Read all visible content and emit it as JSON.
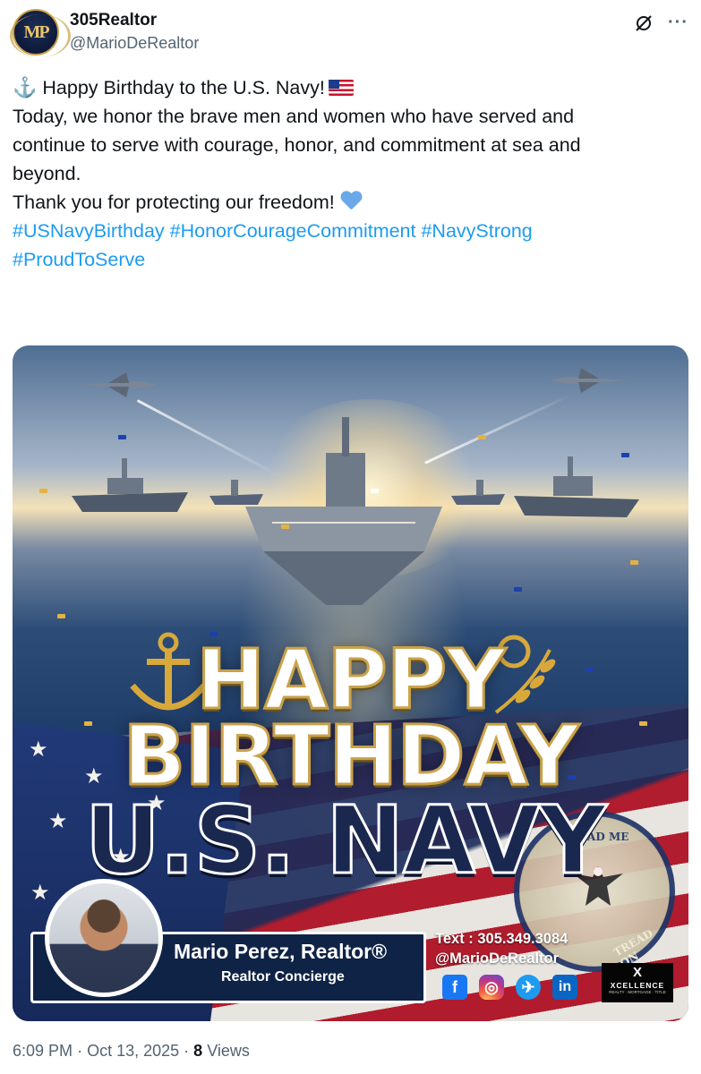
{
  "account": {
    "name": "305Realtor",
    "handle": "@MarioDeRealtor",
    "avatar_icon": "mp-monogram-logo"
  },
  "tweet": {
    "line1": "Happy Birthday to the U.S. Navy!",
    "line2": "Today, we honor the brave men and women who have served and",
    "line3": "continue to serve with courage, honor, and commitment at sea and",
    "line4": "beyond.",
    "line5": "Thank you for protecting our freedom!",
    "hashtags_line1": "#USNavyBirthday #HonorCourageCommitment #NavyStrong",
    "hashtags_line2": "#ProudToServe",
    "emoji": {
      "lead": "anchor-icon",
      "flag": "us-flag-icon",
      "heart": "blue-heart-icon"
    }
  },
  "image": {
    "headline1": "HAPPY",
    "headline2": "BIRTHDAY",
    "headline3": "U.S. NAVY",
    "seal_text_top": "TREAD ME",
    "seal_text_bottom": "TREAD ON",
    "agent_name": "Mario Perez, Realtor®",
    "agent_title": "Realtor Concierge",
    "contact_phone": "Text : 305.349.3084",
    "contact_handle": "@MarioDeRealtor",
    "brand_mark": "X",
    "brand_name": "XCELLENCE",
    "brand_tagline": "REALTY · MORTGAGE · TITLE",
    "social_icons": [
      "facebook-icon",
      "instagram-icon",
      "twitter-icon",
      "linkedin-icon"
    ]
  },
  "footer": {
    "time": "6:09 PM",
    "date": "Oct 13, 2025",
    "views_count": "8",
    "views_label": "Views"
  },
  "colors": {
    "link": "#1d9bf0",
    "secondary_text": "#536471",
    "navy": "#1a2850",
    "gold": "#c9a24a"
  }
}
